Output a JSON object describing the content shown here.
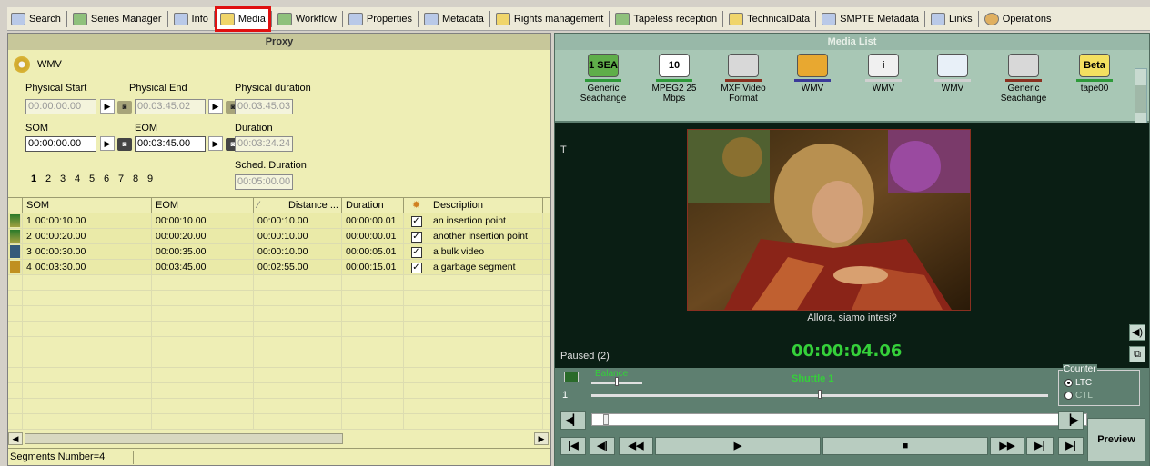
{
  "tabs": [
    {
      "label": "Search",
      "icon": "search-icon"
    },
    {
      "label": "Series Manager",
      "icon": "series-icon"
    },
    {
      "label": "Info",
      "icon": "info-icon"
    },
    {
      "label": "Media",
      "icon": "media-icon",
      "active": true
    },
    {
      "label": "Workflow",
      "icon": "workflow-icon"
    },
    {
      "label": "Properties",
      "icon": "properties-icon"
    },
    {
      "label": "Metadata",
      "icon": "metadata-icon"
    },
    {
      "label": "Rights management",
      "icon": "rights-icon"
    },
    {
      "label": "Tapeless reception",
      "icon": "tapeless-icon"
    },
    {
      "label": "TechnicalData",
      "icon": "technical-icon"
    },
    {
      "label": "SMPTE Metadata",
      "icon": "smpte-icon"
    },
    {
      "label": "Links",
      "icon": "links-icon"
    },
    {
      "label": "Operations",
      "icon": "operations-icon"
    }
  ],
  "proxy": {
    "title": "Proxy",
    "format": "WMV",
    "physical_start_label": "Physical Start",
    "physical_start": "00:00:00.00",
    "physical_end_label": "Physical End",
    "physical_end": "00:03:45.02",
    "physical_duration_label": "Physical duration",
    "physical_duration": "00:03:45.03",
    "som_label": "SOM",
    "som": "00:00:00.00",
    "eom_label": "EOM",
    "eom": "00:03:45.00",
    "duration_label": "Duration",
    "duration": "00:03:24.24",
    "sched_duration_label": "Sched. Duration",
    "sched_duration": "00:05:00.00",
    "pages": [
      "1",
      "2",
      "3",
      "4",
      "5",
      "6",
      "7",
      "8",
      "9"
    ],
    "selected_page": "1"
  },
  "grid": {
    "headers": [
      "SOM",
      "EOM",
      "Distance ...",
      "Duration",
      "",
      "Description"
    ],
    "rows": [
      {
        "num": "1",
        "som": "00:00:10.00",
        "eom": "00:00:10.00",
        "distance": "00:00:10.00",
        "duration": "00:00:00.01",
        "checked": true,
        "description": "an insertion point",
        "icon": "insertion-icon"
      },
      {
        "num": "2",
        "som": "00:00:20.00",
        "eom": "00:00:20.00",
        "distance": "00:00:10.00",
        "duration": "00:00:00.01",
        "checked": true,
        "description": "another insertion point",
        "icon": "insertion-icon"
      },
      {
        "num": "3",
        "som": "00:00:30.00",
        "eom": "00:00:35.00",
        "distance": "00:00:10.00",
        "duration": "00:00:05.01",
        "checked": true,
        "description": "a bulk video",
        "icon": "bulk-video-icon"
      },
      {
        "num": "4",
        "som": "00:03:30.00",
        "eom": "00:03:45.00",
        "distance": "00:02:55.00",
        "duration": "00:00:15.01",
        "checked": true,
        "description": "a garbage segment",
        "icon": "garbage-icon"
      }
    ]
  },
  "status": {
    "segments": "Segments Number=4"
  },
  "media_list": {
    "title": "Media List",
    "items": [
      {
        "label": "Generic Seachange",
        "badge": "1 SEA",
        "bar_color": "#2e9a3a",
        "bg": "#5fae4a"
      },
      {
        "label": "MPEG2 25 Mbps",
        "badge": "10",
        "bar_color": "#2e9a3a",
        "bg": "#ffffff"
      },
      {
        "label": "MXF Video Format",
        "badge": "",
        "bar_color": "#8a3020",
        "bg": "#d8d8d8"
      },
      {
        "label": "WMV",
        "badge": "",
        "bar_color": "#3a3a9a",
        "bg": "#e8a830"
      },
      {
        "label": "WMV",
        "badge": "i",
        "bar_color": "#d0d0d0",
        "bg": "#f0f0f0"
      },
      {
        "label": "WMV",
        "badge": "",
        "bar_color": "#d0d0d0",
        "bg": "#e8f0f8"
      },
      {
        "label": "Generic Seachange",
        "badge": "",
        "bar_color": "#8a3020",
        "bg": "#d8d8d8"
      },
      {
        "label": "tape00",
        "badge": "Beta",
        "bar_color": "#2e9a3a",
        "bg": "#f4e060"
      }
    ]
  },
  "player": {
    "track_label": "T",
    "subtitle": "Allora, siamo intesi?",
    "state": "Paused (2)",
    "timecode": "00:00:04.06",
    "shuttle": "Shuttle 1",
    "balance": "Balance",
    "row_number": "1",
    "counter_label": "Counter",
    "counter_ltc": "LTC",
    "counter_ctl": "CTL",
    "preview": "Preview"
  },
  "colors": {
    "active_tab_outline": "#e01010",
    "timecode": "#35d03a",
    "left_panel_bg": "#eeeeb5",
    "right_panel_bg": "#5e7f70"
  }
}
